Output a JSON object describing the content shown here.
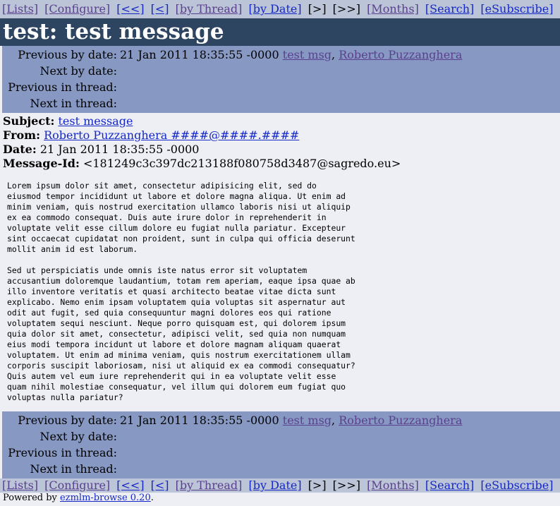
{
  "nav": {
    "lists": "[Lists]",
    "configure": "[Configure]",
    "first": "[<<]",
    "prev": "[<]",
    "by_thread": "[by Thread]",
    "by_date": "[by Date]",
    "next": "[>]",
    "last": "[>>]",
    "months": "[Months]",
    "search": "[Search]",
    "esubscribe": "[eSubscribe]"
  },
  "title": "test: test message",
  "navtable": {
    "prev_by_date_label": "Previous by date:",
    "prev_by_date_value": "21 Jan 2011 18:35:55 -0000",
    "prev_by_date_subject": "test msg",
    "prev_by_date_sep": ",",
    "prev_by_date_author": "Roberto Puzzanghera",
    "next_by_date_label": "Next by date:",
    "prev_in_thread_label": "Previous in thread:",
    "next_in_thread_label": "Next in thread:"
  },
  "headers": {
    "subject_label": "Subject:",
    "subject": "test message",
    "from_label": "From:",
    "from": "Roberto Puzzanghera ####@####.####",
    "date_label": "Date:",
    "date": "21 Jan 2011 18:35:55 -0000",
    "message_id_label": "Message-Id:",
    "message_id": "<181249c3c397dc213188f080758d3487@sagredo.eu>"
  },
  "body": "Lorem ipsum dolor sit amet, consectetur adipisicing elit, sed do\neiusmod tempor incididunt ut labore et dolore magna aliqua. Ut enim ad\nminim veniam, quis nostrud exercitation ullamco laboris nisi ut aliquip\nex ea commodo consequat. Duis aute irure dolor in reprehenderit in\nvoluptate velit esse cillum dolore eu fugiat nulla pariatur. Excepteur\nsint occaecat cupidatat non proident, sunt in culpa qui officia deserunt\nmollit anim id est laborum.\n\nSed ut perspiciatis unde omnis iste natus error sit voluptatem\naccusantium doloremque laudantium, totam rem aperiam, eaque ipsa quae ab\nillo inventore veritatis et quasi architecto beatae vitae dicta sunt\nexplicabo. Nemo enim ipsam voluptatem quia voluptas sit aspernatur aut\nodit aut fugit, sed quia consequuntur magni dolores eos qui ratione\nvoluptatem sequi nesciunt. Neque porro quisquam est, qui dolorem ipsum\nquia dolor sit amet, consectetur, adipisci velit, sed quia non numquam\neius modi tempora incidunt ut labore et dolore magnam aliquam quaerat\nvoluptatem. Ut enim ad minima veniam, quis nostrum exercitationem ullam\ncorporis suscipit laboriosam, nisi ut aliquid ex ea commodi consequatur?\nQuis autem vel eum iure reprehenderit qui in ea voluptate velit esse\nquam nihil molestiae consequatur, vel illum qui dolorem eum fugiat quo\nvoluptas nulla pariatur?",
  "footer": {
    "powered_by": "Powered by",
    "link": "ezmlm-browse 0.20",
    "period": "."
  },
  "colors": {
    "navbar_bg": "#bcc4d8",
    "title_bg": "#2e4562",
    "navtable_bg": "#8799c3",
    "page_bg": "#eeeef5",
    "rss": "#f08a24"
  },
  "icons": {
    "rss": "rss-feed-icon"
  }
}
